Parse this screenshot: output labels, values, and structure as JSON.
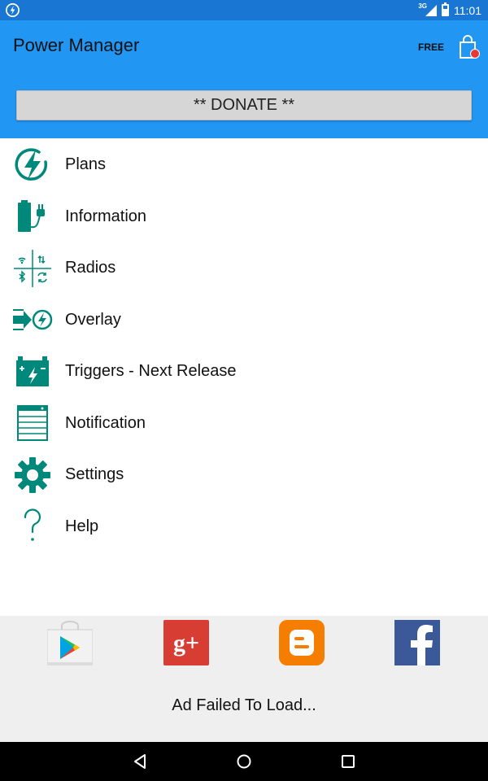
{
  "status_bar": {
    "network": "3G",
    "time": "11:01",
    "icons": [
      "app-bolt-icon",
      "signal-icon",
      "battery-icon"
    ]
  },
  "header": {
    "title": "Power Manager",
    "free_label": "FREE",
    "cart_icon": "shopping-bag-icon",
    "donate_label": "** DONATE **"
  },
  "menu": {
    "items": [
      {
        "label": "Plans",
        "icon": "plans-bolt-icon"
      },
      {
        "label": "Information",
        "icon": "battery-plug-icon"
      },
      {
        "label": "Radios",
        "icon": "radios-icon"
      },
      {
        "label": "Overlay",
        "icon": "overlay-icon"
      },
      {
        "label": "Triggers - Next Release",
        "icon": "triggers-battery-icon"
      },
      {
        "label": "Notification",
        "icon": "notification-icon"
      },
      {
        "label": "Settings",
        "icon": "gear-icon"
      },
      {
        "label": "Help",
        "icon": "question-icon"
      }
    ]
  },
  "footer": {
    "social": [
      "google-play-icon",
      "google-plus-icon",
      "blogger-icon",
      "facebook-icon"
    ],
    "ad_text": "Ad Failed To Load..."
  },
  "nav_bar": {
    "buttons": [
      "back-icon",
      "home-icon",
      "recents-icon"
    ]
  },
  "colors": {
    "status_bar": "#1976d2",
    "header": "#2196f3",
    "icon_teal": "#00897b",
    "footer_bg": "#efefef"
  }
}
